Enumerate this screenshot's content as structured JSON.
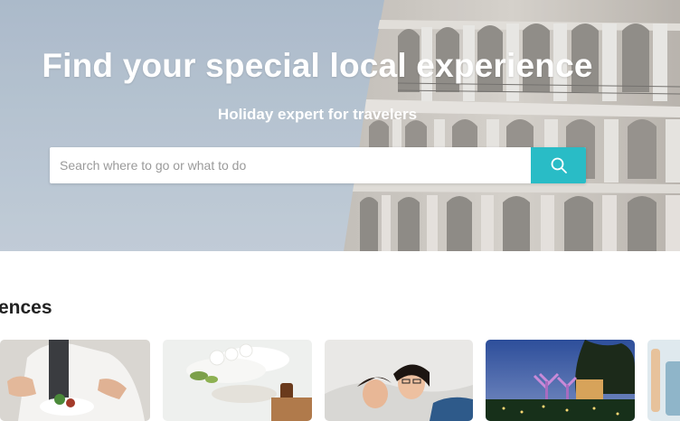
{
  "hero": {
    "title": "Find your special local experience",
    "subtitle": "Holiday expert for travelers"
  },
  "search": {
    "placeholder": "Search where to go or what to do",
    "button_icon": "search-icon",
    "accent_color": "#29bcc6"
  },
  "section": {
    "title": "ences"
  },
  "cards": [
    {
      "image": "chef-plating-food-photo"
    },
    {
      "image": "spa-towels-orchids-photo"
    },
    {
      "image": "smiling-couple-photo"
    },
    {
      "image": "gardens-by-the-bay-night-photo"
    },
    {
      "image": "partial-card-photo"
    }
  ]
}
